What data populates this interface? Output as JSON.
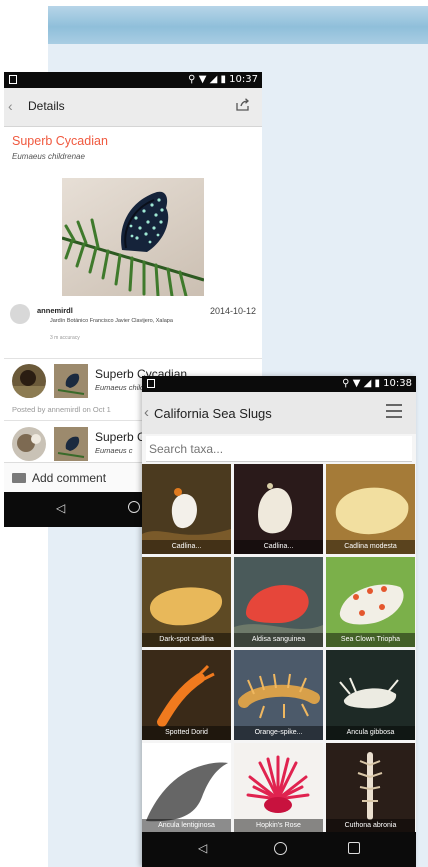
{
  "phone1": {
    "status_time": "10:37",
    "header_title": "Details",
    "species_name": "Superb Cycadian",
    "species_sci": "Eumaeus childrenae",
    "observer": "annemirdl",
    "date": "2014-10-12",
    "place": "Jardín Botánico Francisco Javier Clavijero, Xalapa",
    "accuracy": "3 m accuracy",
    "id1_name": "Superb Cycadian",
    "id1_sci": "Eumaeus childrenae",
    "posted_by": "Posted by annemirdl on Oct 1",
    "id2_name": "Superb C",
    "id2_sci": "Eumaeus c",
    "add_comment": "Add comment"
  },
  "phone2": {
    "status_time": "10:38",
    "title": "California Sea Slugs",
    "search_placeholder": "Search taxa...",
    "tiles": [
      "Cadlina...",
      "Cadlina...",
      "Cadlina modesta",
      "Dark-spot cadlina",
      "Aldisa sanguinea",
      "Sea Clown Triopha",
      "Spotted Dorid",
      "Orange-spike...",
      "Ancula gibbosa",
      "Ancula lentiginosa",
      "Hopkin's Rose",
      "Cuthona abronia"
    ]
  },
  "colors": {
    "accent": "#f0593f",
    "status_bar": "#0b0b0b",
    "background_panel": "#e5eef6"
  }
}
